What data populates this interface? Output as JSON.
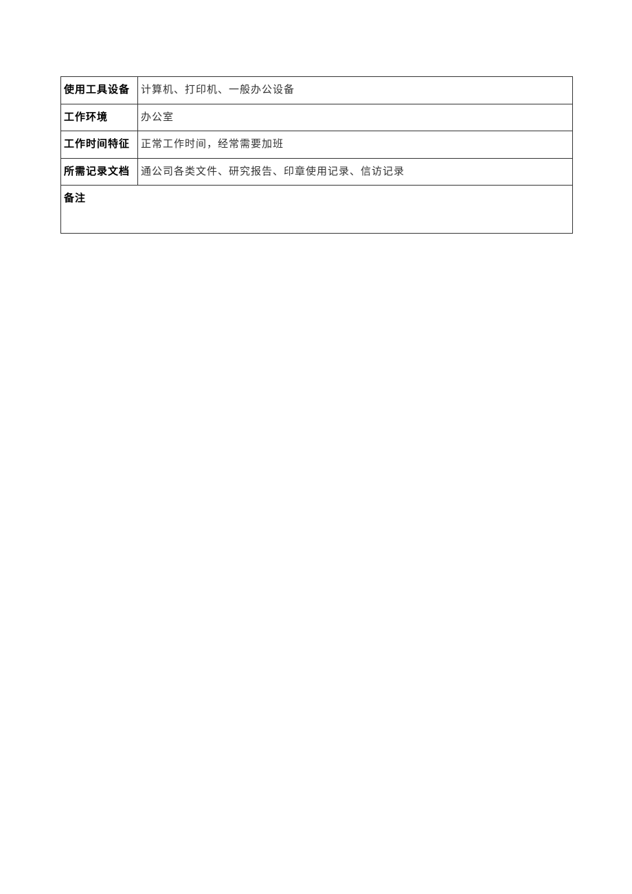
{
  "rows": [
    {
      "label": "使用工具设备",
      "value": "计算机、打印机、一般办公设备"
    },
    {
      "label": "工作环境",
      "value": "办公室"
    },
    {
      "label": "工作时间特征",
      "value": "正常工作时间，经常需要加班"
    },
    {
      "label": "所需记录文档",
      "value": "通公司各类文件、研究报告、印章使用记录、信访记录"
    }
  ],
  "notes": {
    "label": "备注",
    "value": ""
  }
}
